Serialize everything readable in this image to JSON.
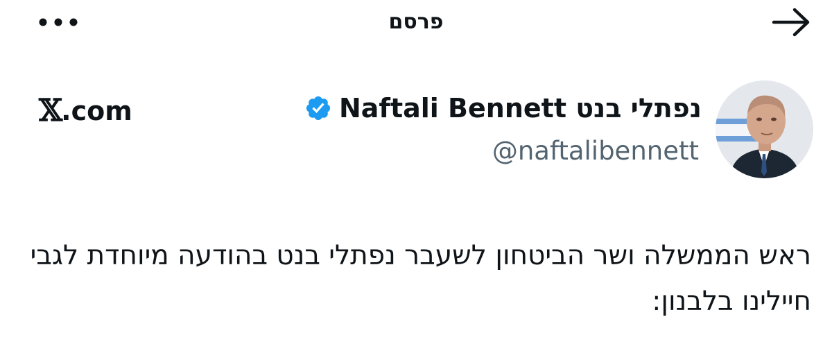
{
  "header": {
    "title": "פרסם",
    "more_icon": "more-horizontal-icon",
    "back_icon": "arrow-right-icon"
  },
  "author": {
    "display_name": "Naftali Bennett נפתלי בנט",
    "handle": "@naftalibennett",
    "verified": true,
    "verified_color": "#1d9bf0",
    "avatar_icon": "profile-photo"
  },
  "source": {
    "logo_glyph": "𝕏",
    "label": ".com"
  },
  "post": {
    "text": "ראש הממשלה ושר הביטחון לשעבר נפתלי בנט בהודעה מיוחדת לגבי חיילינו בלבנון:"
  },
  "colors": {
    "text_primary": "#0f1419",
    "text_secondary": "#536471",
    "accent": "#1d9bf0"
  }
}
